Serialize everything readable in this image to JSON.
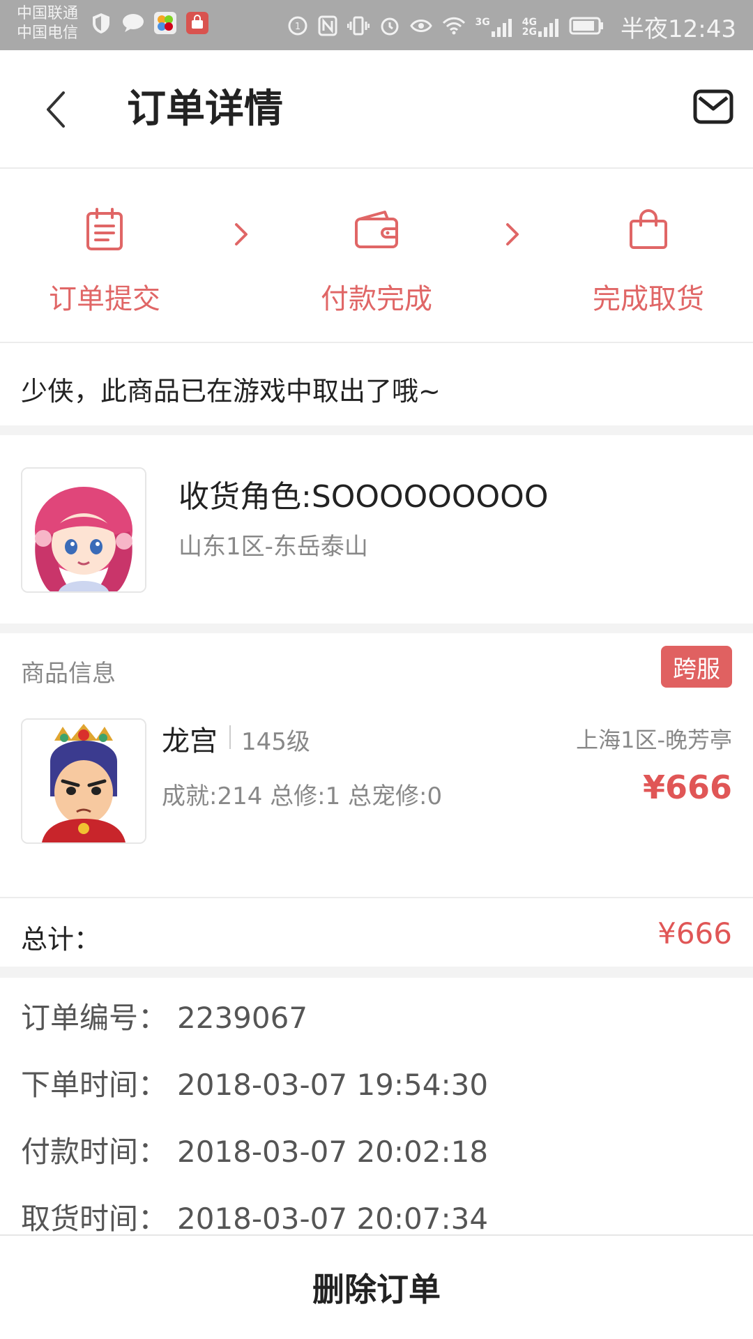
{
  "status_bar": {
    "carrier_1": "中国联通",
    "carrier_2": "中国电信",
    "net_3g": "3G",
    "net_4g": "4G",
    "net_2g": "2G",
    "time": "半夜12:43"
  },
  "header": {
    "title": "订单详情"
  },
  "steps": [
    {
      "label": "订单提交",
      "icon": "clipboard-icon"
    },
    {
      "label": "付款完成",
      "icon": "wallet-icon"
    },
    {
      "label": "完成取货",
      "icon": "bag-icon"
    }
  ],
  "notice": "少侠，此商品已在游戏中取出了哦~",
  "receiver": {
    "name": "收货角色:SOOOOOOOOO",
    "server": "山东1区-东岳泰山"
  },
  "goods": {
    "section_title": "商品信息",
    "badge": "跨服",
    "name": "龙宫",
    "level": "145级",
    "server": "上海1区-晚芳亭",
    "stats": "成就:214 总修:1 总宠修:0",
    "price": "¥666"
  },
  "total": {
    "label": "总计：",
    "value": "¥666"
  },
  "order_info": [
    {
      "label": "订单编号：",
      "value": "2239067"
    },
    {
      "label": "下单时间：",
      "value": "2018-03-07 19:54:30"
    },
    {
      "label": "付款时间：",
      "value": "2018-03-07 20:02:18"
    },
    {
      "label": "取货时间：",
      "value": "2018-03-07 20:07:34"
    }
  ],
  "bottom": {
    "delete_label": "删除订单"
  },
  "colors": {
    "accent": "#e06666",
    "price": "#e05656",
    "badge_bg": "#e06161",
    "status_bar": "#a9a9a9"
  }
}
